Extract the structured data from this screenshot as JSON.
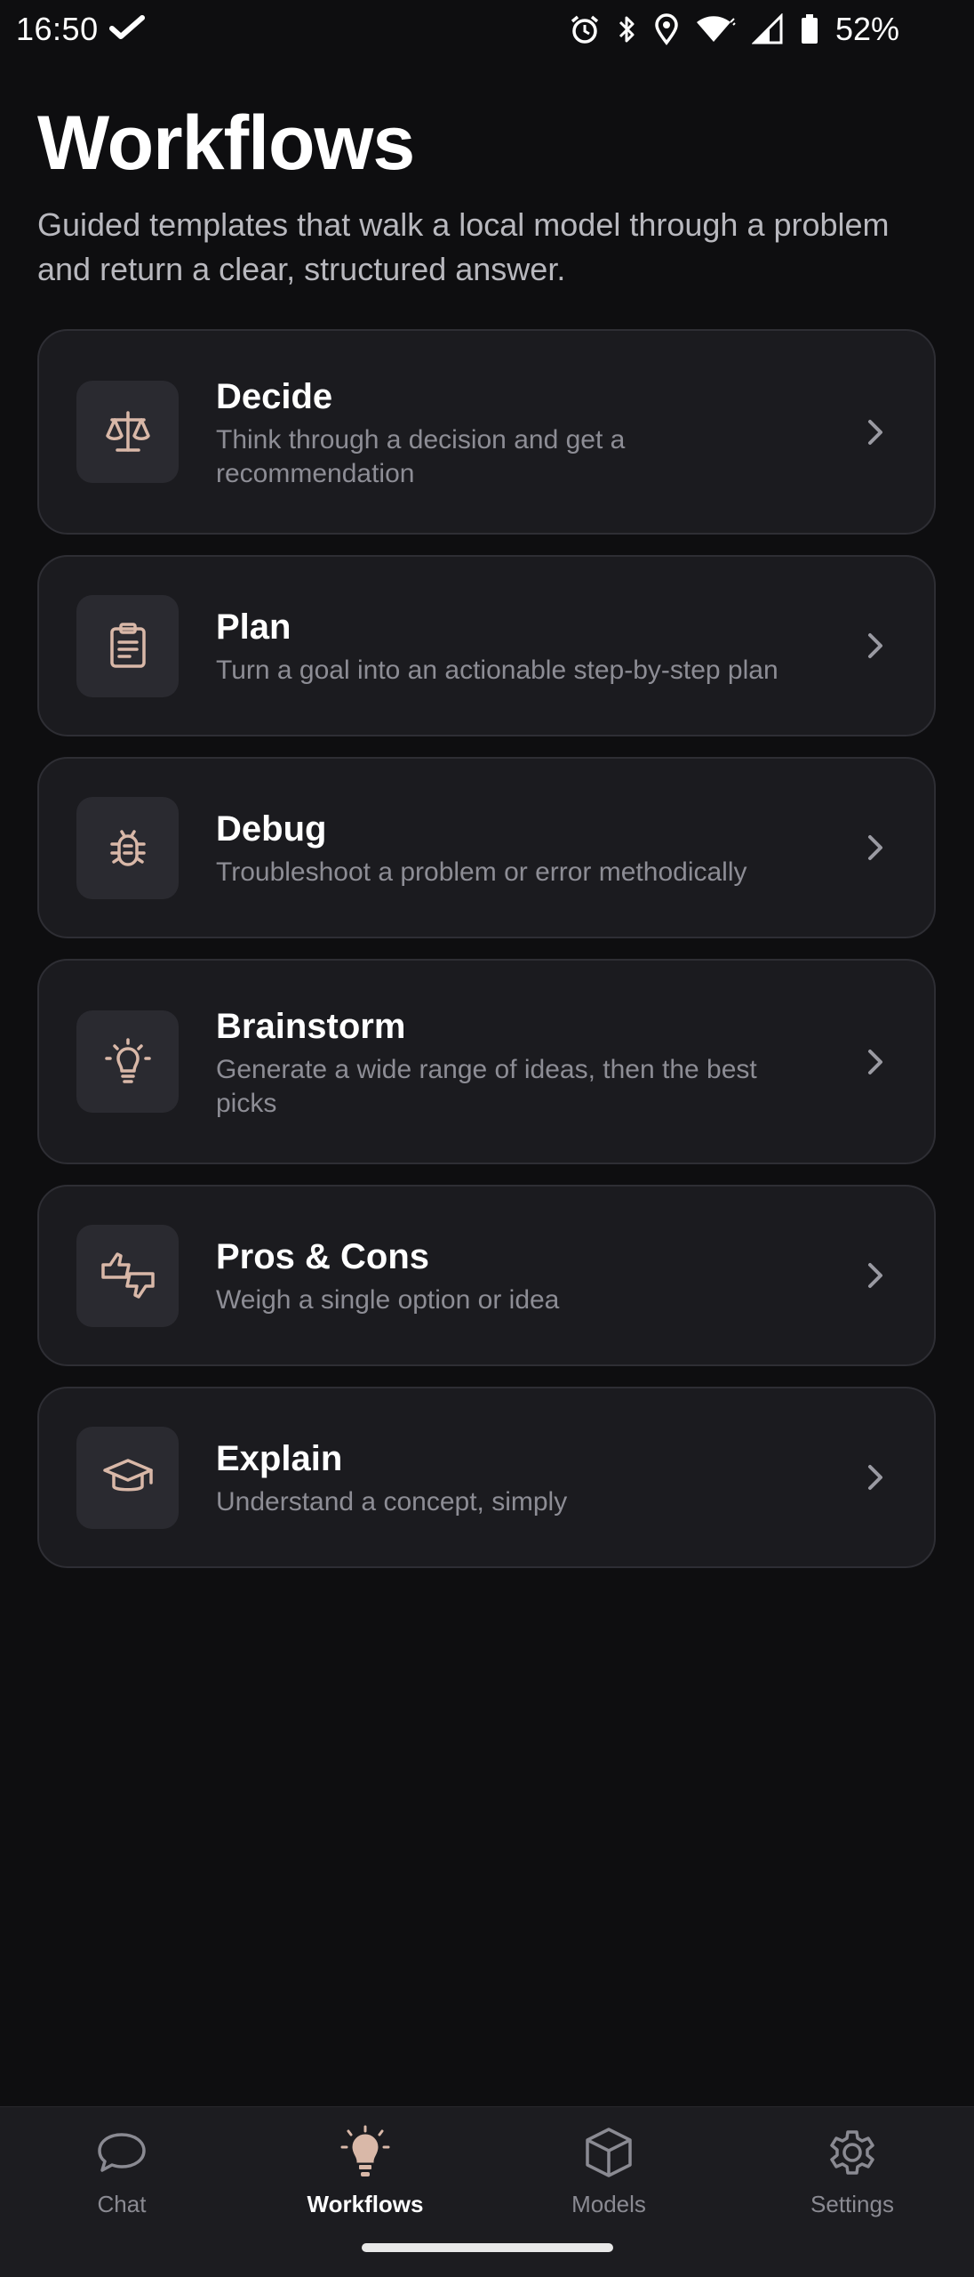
{
  "status_bar": {
    "time": "16:50",
    "battery": "52%",
    "icons": [
      "check-icon",
      "alarm-icon",
      "bluetooth-icon",
      "location-icon",
      "wifi-icon",
      "signal-icon",
      "battery-icon"
    ]
  },
  "header": {
    "title": "Workflows",
    "subtitle": "Guided templates that walk a local model through a problem and return a clear, structured answer."
  },
  "workflows": [
    {
      "title": "Decide",
      "description": "Think through a decision and get a recommendation",
      "icon": "scale-icon"
    },
    {
      "title": "Plan",
      "description": "Turn a goal into an actionable step-by-step plan",
      "icon": "clipboard-icon"
    },
    {
      "title": "Debug",
      "description": "Troubleshoot a problem or error methodically",
      "icon": "bug-icon"
    },
    {
      "title": "Brainstorm",
      "description": "Generate a wide range of ideas, then the best picks",
      "icon": "lightbulb-icon"
    },
    {
      "title": "Pros & Cons",
      "description": "Weigh a single option or idea",
      "icon": "thumbs-up-down-icon"
    },
    {
      "title": "Explain",
      "description": "Understand a concept, simply",
      "icon": "graduation-cap-icon"
    }
  ],
  "nav": {
    "items": [
      {
        "label": "Chat",
        "icon": "chat-bubble-icon"
      },
      {
        "label": "Workflows",
        "icon": "lightbulb-icon",
        "active": true
      },
      {
        "label": "Models",
        "icon": "cube-icon"
      },
      {
        "label": "Settings",
        "icon": "gear-icon"
      }
    ]
  },
  "colors": {
    "background": "#0e0e10",
    "card": "#1b1b1f",
    "icon_accent": "#d9b8a8",
    "muted_text": "#8d8d95"
  }
}
